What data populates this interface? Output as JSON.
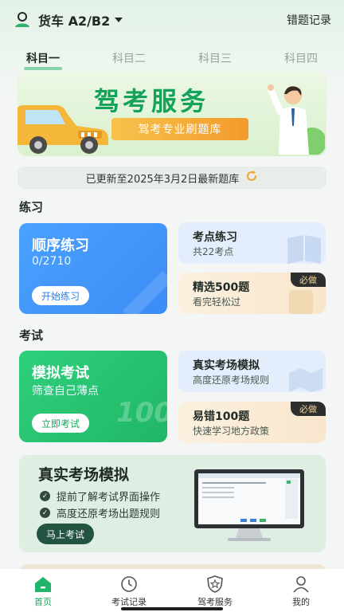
{
  "header": {
    "vehicle_label": "货车 A2/B2",
    "wrong_records": "错题记录"
  },
  "tabs": [
    {
      "label": "科目一",
      "active": true
    },
    {
      "label": "科目二",
      "active": false
    },
    {
      "label": "科目三",
      "active": false
    },
    {
      "label": "科目四",
      "active": false
    }
  ],
  "banner": {
    "title": "驾考服务",
    "subtitle": "驾考专业刷题库"
  },
  "update": {
    "text": "已更新至2025年3月2日最新题库"
  },
  "practice": {
    "section_title": "练习",
    "sequential": {
      "title": "顺序练习",
      "progress": "0/2710",
      "button": "开始练习"
    },
    "points": {
      "title": "考点练习",
      "sub": "共22考点"
    },
    "selected": {
      "title": "精选500题",
      "sub": "看完轻松过",
      "badge": "必做"
    }
  },
  "exam": {
    "section_title": "考试",
    "mock": {
      "title": "模拟考试",
      "sub": "筛查自己薄点",
      "button": "立即考试"
    },
    "real": {
      "title": "真实考场模拟",
      "sub": "高度还原考场规则"
    },
    "error100": {
      "title": "易错100题",
      "sub": "快速学习地方政策",
      "badge": "必做"
    },
    "watermark": "100"
  },
  "simulation": {
    "title": "真实考场模拟",
    "items": [
      "提前了解考试界面操作",
      "高度还原考场出题规则"
    ],
    "button": "马上考试"
  },
  "tabbar": [
    {
      "label": "首页",
      "active": true,
      "icon": "home-icon"
    },
    {
      "label": "考试记录",
      "active": false,
      "icon": "clock-icon"
    },
    {
      "label": "驾考服务",
      "active": false,
      "icon": "shield-star-icon"
    },
    {
      "label": "我的",
      "active": false,
      "icon": "person-icon"
    }
  ],
  "colors": {
    "accent_green": "#1aa95d",
    "blue_card": "#3b8cf5",
    "green_card": "#20b766"
  }
}
